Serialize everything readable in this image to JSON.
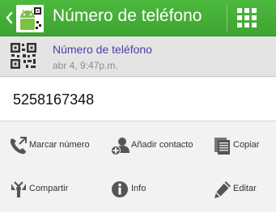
{
  "app": {
    "title": "Número de teléfono",
    "back_icon": "back-chevron-icon",
    "logo_icon": "android-barcode-logo-icon",
    "menu_icon": "grid-menu-icon",
    "accent_color": "#46af38"
  },
  "scan": {
    "format_name": "Número de teléfono",
    "timestamp": "abr 4, 9:47p.m.",
    "format_icon": "qr-code-icon"
  },
  "result": {
    "value": "5258167348"
  },
  "actions": [
    {
      "label": "Marcar número",
      "icon": "dial-phone-icon"
    },
    {
      "label": "Añadir contacto",
      "icon": "add-contact-icon"
    },
    {
      "label": "Copiar",
      "icon": "copy-icon"
    },
    {
      "label": "Compartir",
      "icon": "share-icon"
    },
    {
      "label": "Info",
      "icon": "info-icon"
    },
    {
      "label": "Editar",
      "icon": "edit-pencil-icon"
    }
  ]
}
